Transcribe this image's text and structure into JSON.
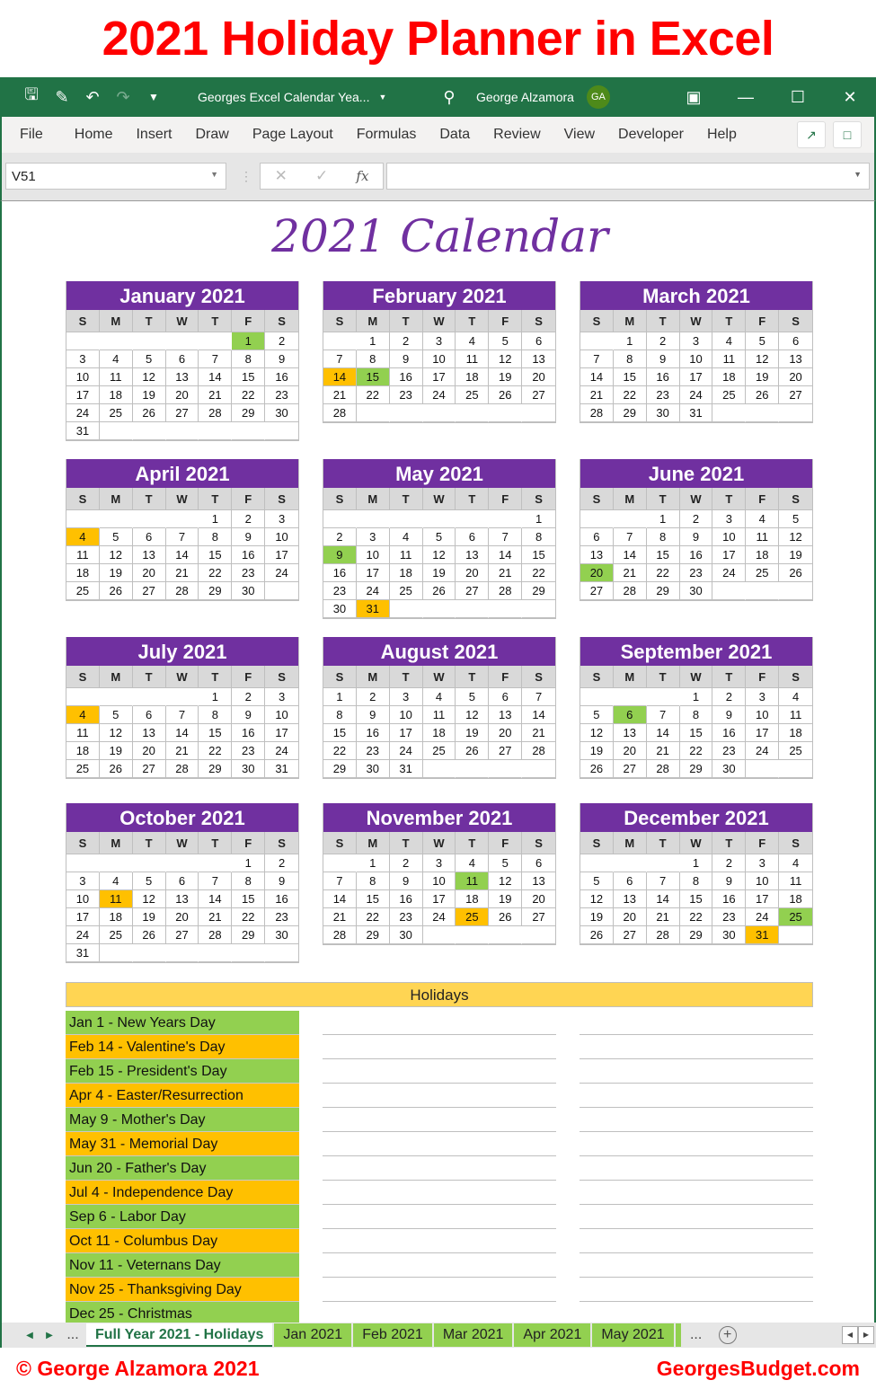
{
  "banner": "2021 Holiday Planner in Excel",
  "titlebar": {
    "doc_title": "Georges Excel Calendar Yea...",
    "user": "George Alzamora",
    "avatar": "GA",
    "icons": [
      "save-icon",
      "save-as-icon",
      "undo-icon",
      "redo-icon",
      "customize-icon",
      "search-icon",
      "ribbon-display-icon",
      "minimize-icon",
      "maximize-icon",
      "close-icon"
    ]
  },
  "ribbon": {
    "tabs": [
      "File",
      "Home",
      "Insert",
      "Draw",
      "Page Layout",
      "Formulas",
      "Data",
      "Review",
      "View",
      "Developer",
      "Help"
    ]
  },
  "formula_bar": {
    "name_box": "V51",
    "formula": ""
  },
  "sheet": {
    "title": "2021 Calendar",
    "dow": [
      "S",
      "M",
      "T",
      "W",
      "T",
      "F",
      "S"
    ],
    "months": [
      {
        "name": "January 2021",
        "start": 5,
        "days": 31,
        "green": [
          1
        ],
        "orange": []
      },
      {
        "name": "February 2021",
        "start": 1,
        "days": 28,
        "green": [
          15
        ],
        "orange": [
          14
        ]
      },
      {
        "name": "March 2021",
        "start": 1,
        "days": 31,
        "green": [],
        "orange": []
      },
      {
        "name": "April 2021",
        "start": 4,
        "days": 30,
        "green": [],
        "orange": [
          4
        ]
      },
      {
        "name": "May 2021",
        "start": 6,
        "days": 31,
        "green": [
          9
        ],
        "orange": [
          31
        ]
      },
      {
        "name": "June 2021",
        "start": 2,
        "days": 30,
        "green": [
          20
        ],
        "orange": []
      },
      {
        "name": "July 2021",
        "start": 4,
        "days": 31,
        "green": [],
        "orange": [
          4
        ]
      },
      {
        "name": "August 2021",
        "start": 0,
        "days": 31,
        "green": [],
        "orange": []
      },
      {
        "name": "September 2021",
        "start": 3,
        "days": 30,
        "green": [
          6
        ],
        "orange": []
      },
      {
        "name": "October 2021",
        "start": 5,
        "days": 31,
        "green": [],
        "orange": [
          11
        ]
      },
      {
        "name": "November 2021",
        "start": 1,
        "days": 30,
        "green": [
          11
        ],
        "orange": [
          25
        ]
      },
      {
        "name": "December 2021",
        "start": 3,
        "days": 31,
        "green": [
          25
        ],
        "orange": [
          31
        ]
      }
    ],
    "holidays_header": "Holidays",
    "holidays": [
      {
        "label": "Jan 1 - New Years Day",
        "color": "green"
      },
      {
        "label": "Feb 14 - Valentine's Day",
        "color": "orange"
      },
      {
        "label": "Feb 15 - President's Day",
        "color": "green"
      },
      {
        "label": "Apr 4 - Easter/Resurrection",
        "color": "orange"
      },
      {
        "label": "May 9 - Mother's Day",
        "color": "green"
      },
      {
        "label": "May 31 - Memorial Day",
        "color": "orange"
      },
      {
        "label": "Jun 20 - Father's Day",
        "color": "green"
      },
      {
        "label": "Jul 4 - Independence Day",
        "color": "orange"
      },
      {
        "label": "Sep 6 - Labor Day",
        "color": "green"
      },
      {
        "label": "Oct 11 - Columbus Day",
        "color": "orange"
      },
      {
        "label": "Nov 11 - Veternans Day",
        "color": "green"
      },
      {
        "label": "Nov 25 - Thanksgiving Day",
        "color": "orange"
      },
      {
        "label": "Dec 25 - Christmas",
        "color": "green"
      }
    ]
  },
  "sheet_tabs": {
    "tabs": [
      "Full Year 2021 - Holidays",
      "Jan 2021",
      "Feb 2021",
      "Mar 2021",
      "Apr 2021",
      "May 2021"
    ],
    "active": 0,
    "more": "...",
    "overflow": "..."
  },
  "colors": {
    "excel_green": "#217346",
    "purple": "#7030a0",
    "holiday_green": "#92d050",
    "holiday_orange": "#ffc000",
    "header_yellow": "#ffd553",
    "banner_red": "#ff0000"
  },
  "footer": {
    "left": "© George Alzamora 2021",
    "right": "GeorgesBudget.com"
  }
}
